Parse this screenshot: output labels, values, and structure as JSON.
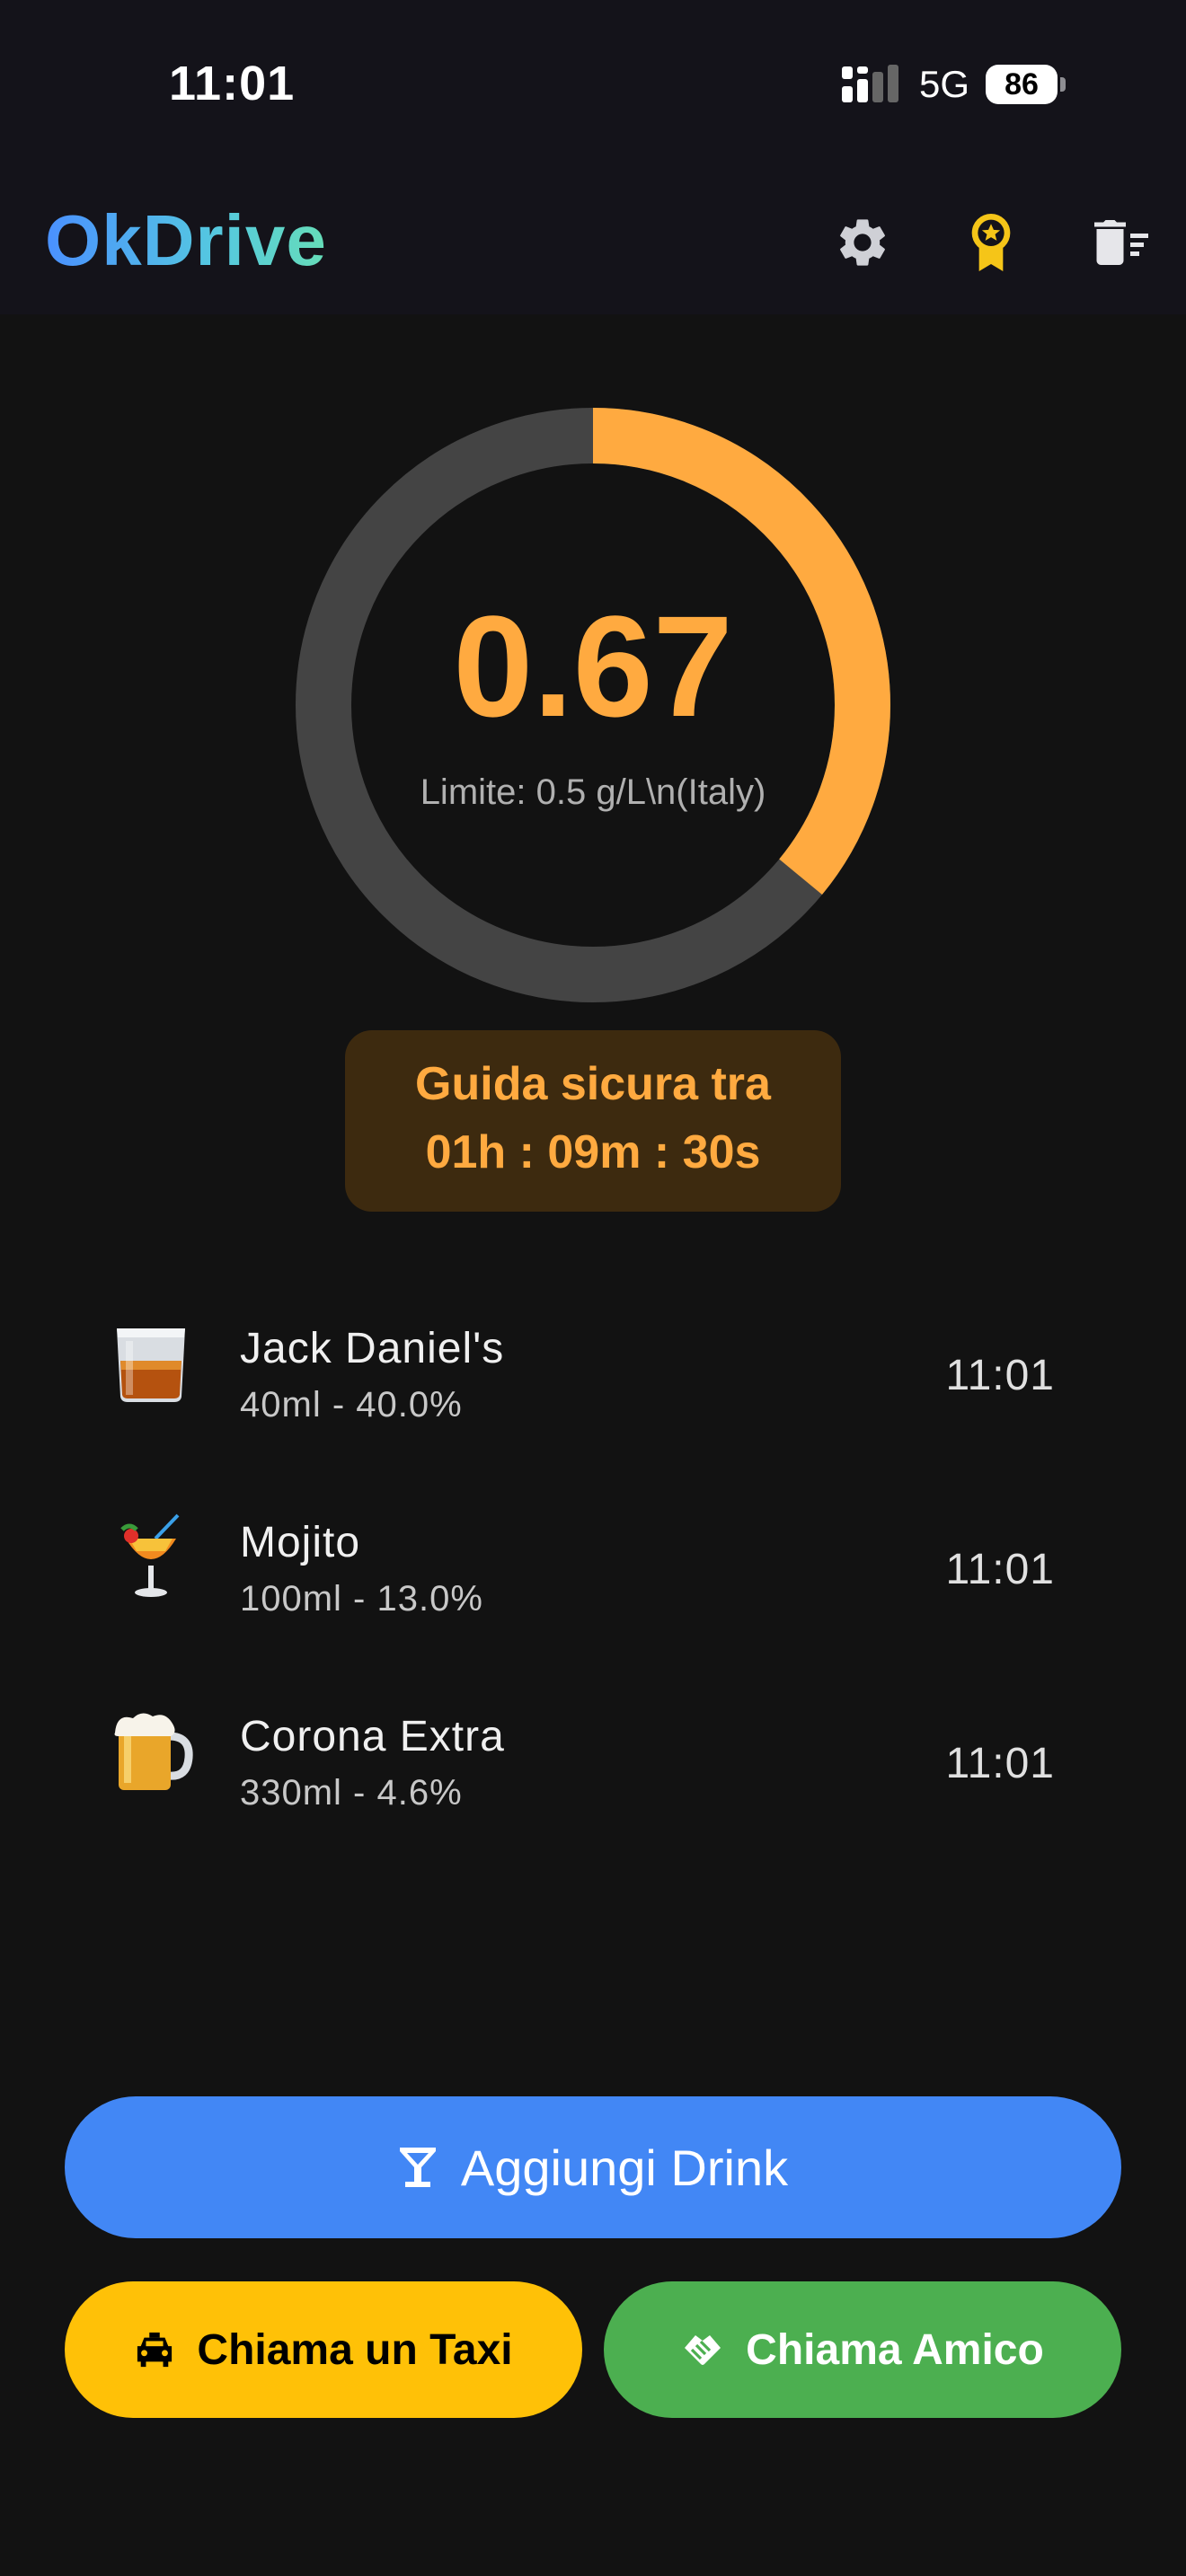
{
  "status_bar": {
    "time": "11:01",
    "network": "5G",
    "battery": "86"
  },
  "app": {
    "title": "OkDrive"
  },
  "gauge": {
    "value": "0.67",
    "limit_text": "Limite: 0.5 g/L\\n(Italy)",
    "progress_fraction": 0.36,
    "progress_color": "#ffaa40",
    "track_color": "#444444"
  },
  "safe_drive": {
    "line1": "Guida sicura tra",
    "line2": "01h : 09m : 30s"
  },
  "drinks": [
    {
      "name": "Jack Daniel's",
      "detail": "40ml - 40.0%",
      "time": "11:01",
      "icon": "whiskey-glass-icon"
    },
    {
      "name": "Mojito",
      "detail": "100ml - 13.0%",
      "time": "11:01",
      "icon": "tropical-drink-icon"
    },
    {
      "name": "Corona Extra",
      "detail": "330ml - 4.6%",
      "time": "11:01",
      "icon": "beer-mug-icon"
    }
  ],
  "actions": {
    "add_drink": "Aggiungi Drink",
    "call_taxi": "Chiama un Taxi",
    "call_friend": "Chiama Amico"
  },
  "colors": {
    "accent_orange": "#ffaa40",
    "add_blue": "#4287f5",
    "taxi_yellow": "#ffc107",
    "friend_green": "#4caf50"
  }
}
